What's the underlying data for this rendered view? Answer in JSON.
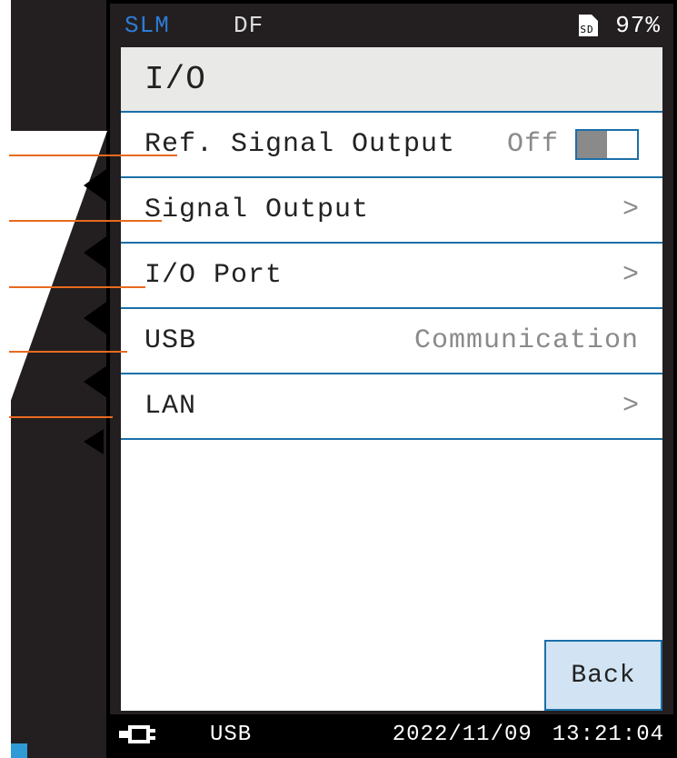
{
  "status": {
    "slm": "SLM",
    "mode": "DF",
    "sd_label": "SD",
    "battery": "97%"
  },
  "page": {
    "title": "I/O"
  },
  "menu": {
    "items": [
      {
        "label": "Ref. Signal Output",
        "value": "Off",
        "type": "toggle",
        "toggle_state": "off"
      },
      {
        "label": "Signal Output",
        "value": "",
        "type": "submenu"
      },
      {
        "label": "I/O Port",
        "value": "",
        "type": "submenu"
      },
      {
        "label": "USB",
        "value": "Communication",
        "type": "value"
      },
      {
        "label": "LAN",
        "value": "",
        "type": "submenu"
      }
    ]
  },
  "buttons": {
    "back": "Back"
  },
  "bottom": {
    "connection": "USB",
    "date": "2022/11/09",
    "time": "13:21:04"
  },
  "chevron_glyph": ">"
}
